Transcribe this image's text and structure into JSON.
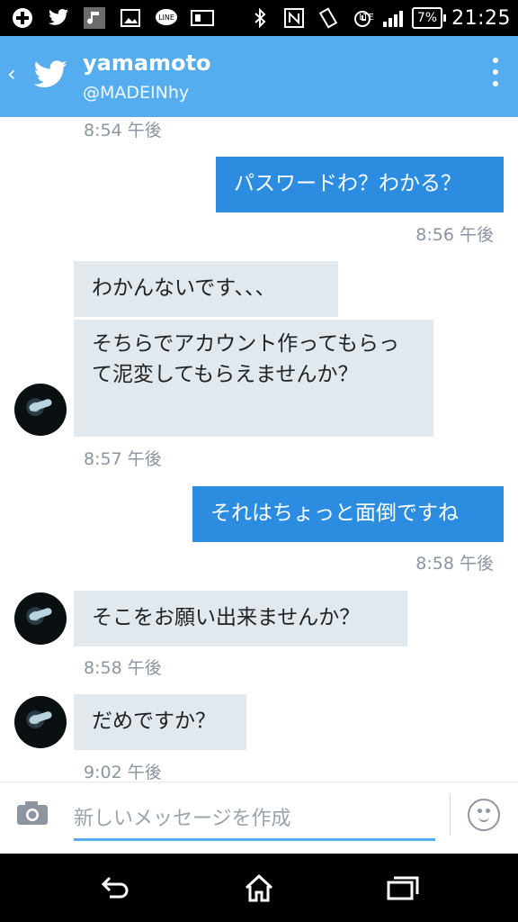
{
  "status_bar": {
    "battery": "7%",
    "time": "21:25",
    "network": "LTE"
  },
  "header": {
    "name": "yamamoto",
    "handle": "@MADEINhy"
  },
  "messages": [
    {
      "type": "timestamp",
      "text": "8:54 午後"
    },
    {
      "type": "outgoing",
      "text": "パスワードわ？わかる？"
    },
    {
      "type": "timestamp",
      "text": "8:56 午後"
    },
    {
      "type": "incoming",
      "text": "わかんないです、、、"
    },
    {
      "type": "incoming",
      "text": "そちらでアカウント作ってもらって泥変してもらえませんか？"
    },
    {
      "type": "timestamp",
      "text": "8:57 午後"
    },
    {
      "type": "outgoing",
      "text": "それはちょっと面倒ですね"
    },
    {
      "type": "timestamp",
      "text": "8:58 午後"
    },
    {
      "type": "incoming",
      "text": "そこをお願い出来ませんか？"
    },
    {
      "type": "timestamp",
      "text": "8:58 午後"
    },
    {
      "type": "incoming",
      "text": "だめですか？"
    },
    {
      "type": "timestamp",
      "text": "9:02 午後"
    }
  ],
  "composer": {
    "placeholder": "新しいメッセージを作成"
  },
  "colors": {
    "accent": "#55acee",
    "outgoing_bubble": "#2c8de0",
    "incoming_bubble": "#e1e8ee",
    "timestamp": "#8b96a1"
  }
}
